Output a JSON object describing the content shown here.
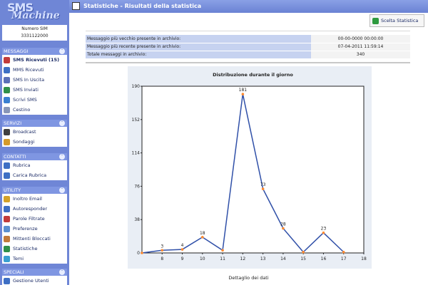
{
  "sidebar": {
    "logo_line1": "SMS",
    "logo_line2": "Machine",
    "sim_label": "Numero SIM",
    "sim_number": "3331122000",
    "sections": [
      {
        "title": "MESSAGGI",
        "items": [
          {
            "label": "SMS Ricevuti (15)",
            "icon": "sms-received-icon",
            "color": "#c23b3b"
          },
          {
            "label": "MMS Ricevuti",
            "icon": "mms-received-icon",
            "color": "#3e6fc4"
          },
          {
            "label": "SMS In Uscita",
            "icon": "sms-outgoing-icon",
            "color": "#5b6fb8"
          },
          {
            "label": "SMS Inviati",
            "icon": "sms-sent-icon",
            "color": "#2f8f4a"
          },
          {
            "label": "Scrivi SMS",
            "icon": "write-sms-icon",
            "color": "#3a7fd0"
          },
          {
            "label": "Cestino",
            "icon": "trash-icon",
            "color": "#8896b8"
          }
        ]
      },
      {
        "title": "SERVIZI",
        "items": [
          {
            "label": "Broadcast",
            "icon": "broadcast-icon",
            "color": "#404040"
          },
          {
            "label": "Sondaggi",
            "icon": "poll-icon",
            "color": "#d49a2a"
          }
        ]
      },
      {
        "title": "CONTATTI",
        "items": [
          {
            "label": "Rubrica",
            "icon": "addressbook-icon",
            "color": "#3e6fc4"
          },
          {
            "label": "Carica Rubrica",
            "icon": "upload-addressbook-icon",
            "color": "#3e6fc4"
          }
        ]
      },
      {
        "title": "UTILITY",
        "items": [
          {
            "label": "Inoltro Email",
            "icon": "email-forward-icon",
            "color": "#d4a22a"
          },
          {
            "label": "Autoresponder",
            "icon": "autoresponder-icon",
            "color": "#3e6fc4"
          },
          {
            "label": "Parole Filtrate",
            "icon": "filter-words-icon",
            "color": "#c23b3b"
          },
          {
            "label": "Preferenze",
            "icon": "preferences-icon",
            "color": "#5b8fd0"
          },
          {
            "label": "Mittenti Bloccati",
            "icon": "blocked-senders-icon",
            "color": "#c27a3b"
          },
          {
            "label": "Statistiche",
            "icon": "statistics-icon",
            "color": "#2f8f4a"
          },
          {
            "label": "Temi",
            "icon": "themes-icon",
            "color": "#3a9fd0"
          }
        ]
      },
      {
        "title": "SPECIALI",
        "items": [
          {
            "label": "Gestione Utenti",
            "icon": "users-icon",
            "color": "#3e6fc4"
          }
        ]
      }
    ]
  },
  "header": {
    "title": "Statistiche - Risultati della statistica"
  },
  "toolbar": {
    "scelta_label": "Scelta Statistica"
  },
  "info": [
    {
      "label": "Messaggio più vecchio presente in archivio:",
      "value": "00-00-0000 00:00:00"
    },
    {
      "label": "Messaggio più recente presente in archivio:",
      "value": "07-04-2011 11:59:14"
    },
    {
      "label": "Totale messaggi in archivio:",
      "value": "340"
    }
  ],
  "footer": {
    "detail_label": "Dettaglio dei dati"
  },
  "colors": {
    "line": "#3050a8",
    "marker": "#ff8a30",
    "sidebar": "#6f86d6"
  },
  "chart_data": {
    "type": "line",
    "title": "Distribuzione durante il giorno",
    "x": [
      7,
      8,
      9,
      10,
      11,
      12,
      13,
      14,
      15,
      16,
      17,
      18
    ],
    "xticks": [
      "8",
      "9",
      "10",
      "11",
      "12",
      "13",
      "14",
      "15",
      "16",
      "17",
      "18"
    ],
    "yticks": [
      "0",
      "38",
      "76",
      "114",
      "152",
      "190"
    ],
    "series": [
      {
        "values": [
          0,
          3,
          4,
          18,
          3,
          181,
          73,
          28,
          1,
          23,
          1
        ],
        "labels": [
          "",
          "3",
          "4",
          "18",
          "",
          "181",
          "73",
          "28",
          "",
          "23",
          ""
        ]
      }
    ],
    "ylim": [
      0,
      190
    ],
    "grid": false
  }
}
